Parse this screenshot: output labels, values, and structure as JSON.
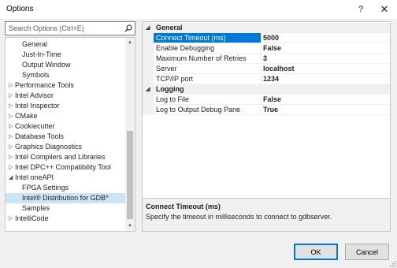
{
  "window": {
    "title": "Options",
    "help_glyph": "?",
    "close_glyph": "✕"
  },
  "search": {
    "placeholder": "Search Options (Ctrl+E)",
    "value": ""
  },
  "tree": {
    "items": [
      {
        "label": "General",
        "level": 1,
        "expander": ""
      },
      {
        "label": "Just-In-Time",
        "level": 1,
        "expander": ""
      },
      {
        "label": "Output Window",
        "level": 1,
        "expander": ""
      },
      {
        "label": "Symbols",
        "level": 1,
        "expander": ""
      },
      {
        "label": "Performance Tools",
        "level": 0,
        "expander": "▷"
      },
      {
        "label": "Intel Advisor",
        "level": 0,
        "expander": "▷"
      },
      {
        "label": "Intel Inspector",
        "level": 0,
        "expander": "▷"
      },
      {
        "label": "CMake",
        "level": 0,
        "expander": "▷"
      },
      {
        "label": "Cookiecutter",
        "level": 0,
        "expander": "▷"
      },
      {
        "label": "Database Tools",
        "level": 0,
        "expander": "▷"
      },
      {
        "label": "Graphics Diagnostics",
        "level": 0,
        "expander": "▷"
      },
      {
        "label": "Intel Compilers and Libraries",
        "level": 0,
        "expander": "▷"
      },
      {
        "label": "Intel DPC++ Compatibility Tool",
        "level": 0,
        "expander": "▷"
      },
      {
        "label": "Intel oneAPI",
        "level": 0,
        "expander": "◢"
      },
      {
        "label": "FPGA Settings",
        "level": 1,
        "expander": ""
      },
      {
        "label": "Intel® Distribution for GDB*",
        "level": 1,
        "expander": "",
        "selected": true
      },
      {
        "label": "Samples",
        "level": 1,
        "expander": ""
      },
      {
        "label": "IntelliCode",
        "level": 0,
        "expander": "▷"
      }
    ]
  },
  "properties": {
    "categories": [
      {
        "name": "General",
        "expander": "◢",
        "rows": [
          {
            "name": "Connect Timeout (ms)",
            "value": "5000",
            "selected": true
          },
          {
            "name": "Enable Debugging",
            "value": "False"
          },
          {
            "name": "Maximum Number of Retries",
            "value": "3"
          },
          {
            "name": "Server",
            "value": "localhost"
          },
          {
            "name": "TCP/IP port",
            "value": "1234"
          }
        ]
      },
      {
        "name": "Logging",
        "expander": "◢",
        "rows": [
          {
            "name": "Log to File",
            "value": "False"
          },
          {
            "name": "Log to Output Debug Pane",
            "value": "True"
          }
        ]
      }
    ]
  },
  "description": {
    "title": "Connect Timeout (ms)",
    "text": "Specify the timeout in milliseconds to connect to gdbserver."
  },
  "buttons": {
    "ok": "OK",
    "cancel": "Cancel"
  },
  "colors": {
    "selection_accent": "#0078d7",
    "tree_selection": "#cce4f7"
  }
}
